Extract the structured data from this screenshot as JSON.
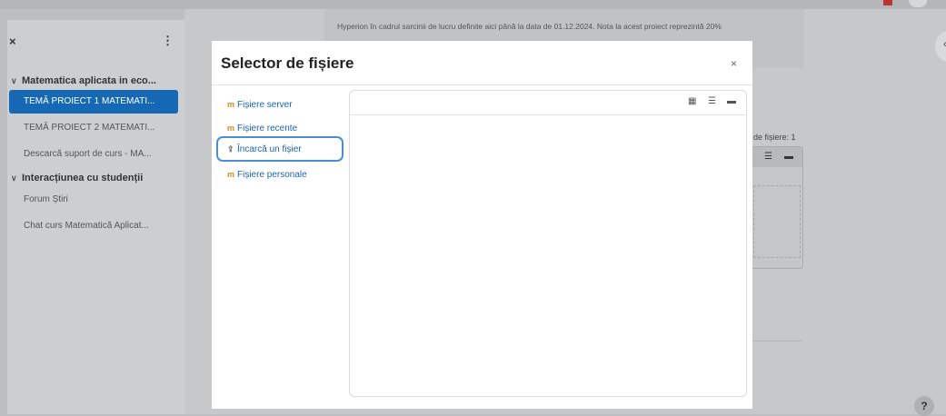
{
  "course": {
    "description": "Hyperion în cadrul sarcinii de lucru definite aici până la data de 01.12.2024. Nota la acest proiect reprezintă 20%",
    "files_label": "de fișiere: 1"
  },
  "sidebar": {
    "close_glyph": "×",
    "menu_glyph": "⋮",
    "sections": [
      {
        "title": "Matematica aplicata in eco...",
        "items": [
          {
            "label": "TEMĂ PROIECT 1 MATEMATI...",
            "active": true
          },
          {
            "label": "TEMĂ PROIECT 2 MATEMATI...",
            "active": false
          },
          {
            "label": "Descarcă suport de curs - MA...",
            "active": false
          }
        ]
      },
      {
        "title": "Interacțiunea cu studenții",
        "items": [
          {
            "label": "Forum Știri",
            "active": false
          },
          {
            "label": "Chat curs Matematică Aplicat...",
            "active": false
          }
        ]
      }
    ]
  },
  "dialog": {
    "title": "Selector de fișiere",
    "close_glyph": "×",
    "repositories": [
      {
        "label": "Fișiere server",
        "icon": "moodle-icon",
        "active": false
      },
      {
        "label": "Fișiere recente",
        "icon": "moodle-icon",
        "active": false
      },
      {
        "label": "Încarcă un fișier",
        "icon": "upload-icon",
        "active": true
      },
      {
        "label": "Fișiere personale",
        "icon": "moodle-icon",
        "active": false
      }
    ],
    "view_buttons": [
      {
        "name": "view-icons-icon",
        "glyph": "▦"
      },
      {
        "name": "view-list-icon",
        "glyph": "☰"
      },
      {
        "name": "view-tree-icon",
        "glyph": "▬"
      }
    ]
  },
  "help": {
    "glyph": "?"
  },
  "colors": {
    "active_item": "#1569b4",
    "link": "#1a64b0",
    "focus_border": "#4a8fd4"
  }
}
